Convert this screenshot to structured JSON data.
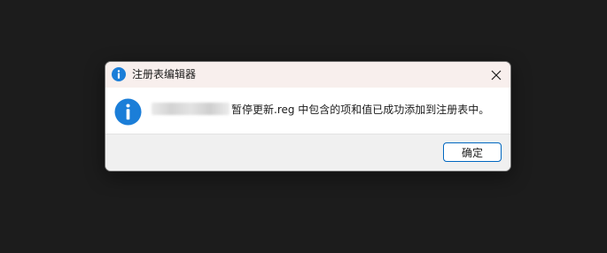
{
  "dialog": {
    "title": "注册表编辑器",
    "message_suffix": "暂停更新.reg 中包含的项和值已成功添加到注册表中。",
    "ok_label": "确定",
    "icon": "info-icon",
    "close_icon": "close-icon"
  },
  "colors": {
    "background": "#1c1c1c",
    "titlebar": "#f8efed",
    "info_blue": "#1b7ed8",
    "button_border": "#0067c0"
  }
}
